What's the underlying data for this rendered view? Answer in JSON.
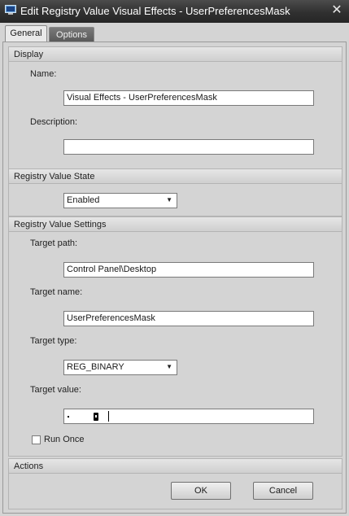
{
  "window": {
    "title": "Edit Registry Value Visual Effects - UserPreferencesMask",
    "app_icon": "registry-editor-icon",
    "close_icon": "close-icon"
  },
  "tabs": [
    {
      "label": "General",
      "active": true
    },
    {
      "label": "Options",
      "active": false
    }
  ],
  "display": {
    "header": "Display",
    "name_label": "Name:",
    "name_value": "Visual Effects - UserPreferencesMask",
    "description_label": "Description:",
    "description_value": ""
  },
  "state": {
    "header": "Registry Value State",
    "value": "Enabled"
  },
  "settings": {
    "header": "Registry Value Settings",
    "target_path_label": "Target path:",
    "target_path_value": "Control Panel\\Desktop",
    "target_name_label": "Target name:",
    "target_name_value": "UserPreferencesMask",
    "target_type_label": "Target type:",
    "target_type_value": "REG_BINARY",
    "target_value_label": "Target value:",
    "run_once_label": "Run Once",
    "run_once_checked": false
  },
  "actions": {
    "header": "Actions",
    "ok_label": "OK",
    "cancel_label": "Cancel"
  }
}
